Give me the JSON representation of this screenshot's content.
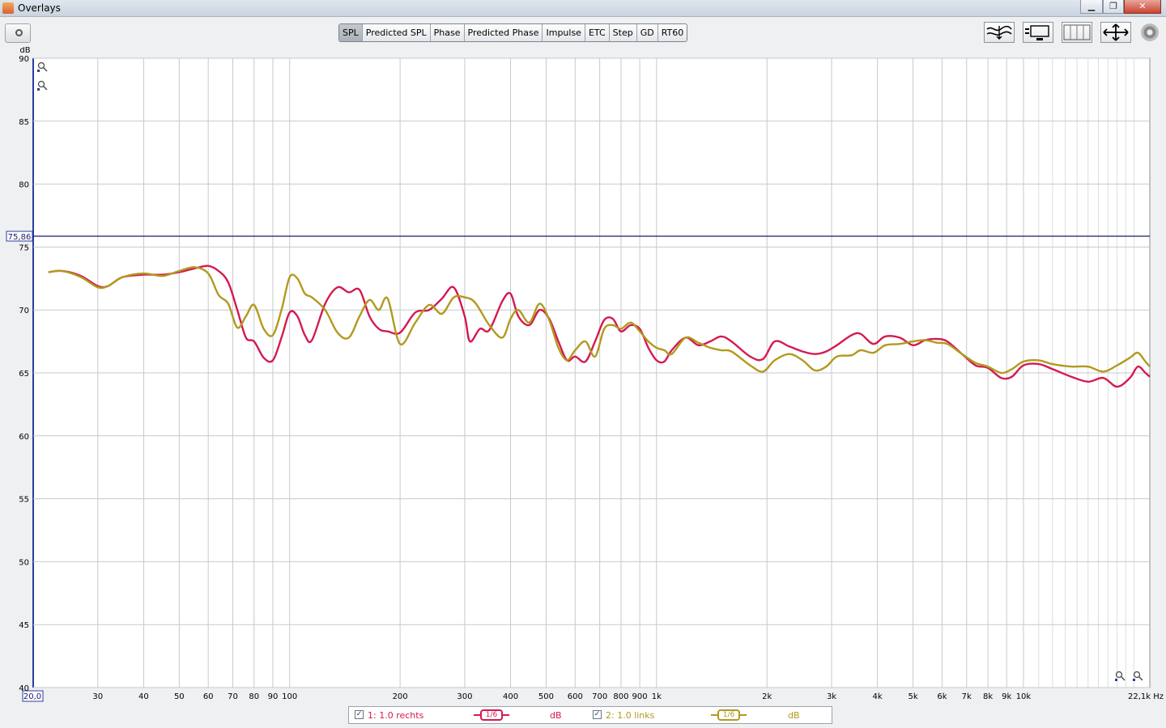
{
  "window": {
    "title": "Overlays",
    "btn_min": "▁",
    "btn_max": "❐",
    "btn_close": "✕"
  },
  "toolbar": {
    "tabs": [
      "SPL",
      "Predicted SPL",
      "Phase",
      "Predicted Phase",
      "Impulse",
      "ETC",
      "Step",
      "GD",
      "RT60"
    ],
    "active_tab": "SPL",
    "icons": [
      "capture-camera-icon",
      "align-traces-icon",
      "trace-arrangement-icon",
      "vertical-lines-icon",
      "fit-to-view-icon",
      "settings-gear-icon"
    ]
  },
  "chart": {
    "y_unit": "dB",
    "y_ticks": [
      "90",
      "85",
      "80",
      "75",
      "70",
      "65",
      "60",
      "55",
      "50",
      "45",
      "40"
    ],
    "x_ticks": [
      "30",
      "40",
      "50",
      "60",
      "70",
      "80",
      "90",
      "100",
      "200",
      "300",
      "400",
      "500",
      "600",
      "700",
      "800",
      "900",
      "1k",
      "2k",
      "3k",
      "4k",
      "5k",
      "6k",
      "7k",
      "8k",
      "9k",
      "10k"
    ],
    "x_start_label": "20,0",
    "x_end_label": "22,1k Hz",
    "cursor_label": "75,86"
  },
  "chart_data": {
    "type": "line",
    "x_scale": "log",
    "xlim": [
      20,
      22100
    ],
    "ylim": [
      40,
      90
    ],
    "grid": true,
    "cursor_y": 75.86,
    "series": [
      {
        "name": "1: 1.0 rechts",
        "color": "#d41a50",
        "points": [
          [
            22,
            73
          ],
          [
            24,
            73.1
          ],
          [
            27,
            72.7
          ],
          [
            30,
            71.9
          ],
          [
            32,
            71.9
          ],
          [
            35,
            72.6
          ],
          [
            40,
            72.8
          ],
          [
            45,
            72.8
          ],
          [
            50,
            73
          ],
          [
            55,
            73.3
          ],
          [
            60,
            73.5
          ],
          [
            64,
            73.1
          ],
          [
            68,
            72.2
          ],
          [
            72,
            70
          ],
          [
            76,
            67.8
          ],
          [
            80,
            67.5
          ],
          [
            85,
            66.2
          ],
          [
            90,
            66
          ],
          [
            95,
            67.8
          ],
          [
            100,
            69.8
          ],
          [
            105,
            69.5
          ],
          [
            110,
            68
          ],
          [
            115,
            67.6
          ],
          [
            125,
            70.5
          ],
          [
            135,
            71.8
          ],
          [
            145,
            71.4
          ],
          [
            155,
            71.6
          ],
          [
            165,
            69.5
          ],
          [
            175,
            68.5
          ],
          [
            185,
            68.3
          ],
          [
            200,
            68.2
          ],
          [
            220,
            69.8
          ],
          [
            240,
            70
          ],
          [
            260,
            70.9
          ],
          [
            280,
            71.8
          ],
          [
            300,
            69.5
          ],
          [
            310,
            67.5
          ],
          [
            330,
            68.5
          ],
          [
            350,
            68.4
          ],
          [
            380,
            70.7
          ],
          [
            400,
            71.3
          ],
          [
            420,
            69.5
          ],
          [
            450,
            68.8
          ],
          [
            480,
            70
          ],
          [
            510,
            69.3
          ],
          [
            540,
            67.5
          ],
          [
            570,
            66
          ],
          [
            600,
            66.3
          ],
          [
            640,
            65.9
          ],
          [
            680,
            67.5
          ],
          [
            720,
            69.2
          ],
          [
            760,
            69.3
          ],
          [
            800,
            68.3
          ],
          [
            850,
            68.8
          ],
          [
            900,
            68.5
          ],
          [
            950,
            67
          ],
          [
            1000,
            66
          ],
          [
            1050,
            65.9
          ],
          [
            1100,
            66.8
          ],
          [
            1200,
            67.8
          ],
          [
            1300,
            67.2
          ],
          [
            1400,
            67.5
          ],
          [
            1500,
            67.9
          ],
          [
            1600,
            67.5
          ],
          [
            1800,
            66.3
          ],
          [
            1950,
            66.1
          ],
          [
            2100,
            67.5
          ],
          [
            2300,
            67.1
          ],
          [
            2500,
            66.7
          ],
          [
            2700,
            66.5
          ],
          [
            2900,
            66.7
          ],
          [
            3100,
            67.2
          ],
          [
            3400,
            68
          ],
          [
            3600,
            68.1
          ],
          [
            3900,
            67.3
          ],
          [
            4200,
            67.9
          ],
          [
            4600,
            67.8
          ],
          [
            5000,
            67.2
          ],
          [
            5400,
            67.6
          ],
          [
            5800,
            67.7
          ],
          [
            6200,
            67.5
          ],
          [
            6800,
            66.5
          ],
          [
            7400,
            65.6
          ],
          [
            8000,
            65.4
          ],
          [
            8700,
            64.6
          ],
          [
            9300,
            64.7
          ],
          [
            10000,
            65.6
          ],
          [
            11000,
            65.7
          ],
          [
            12000,
            65.3
          ],
          [
            13500,
            64.7
          ],
          [
            15000,
            64.3
          ],
          [
            16500,
            64.6
          ],
          [
            18000,
            63.9
          ],
          [
            19500,
            64.6
          ],
          [
            20500,
            65.5
          ],
          [
            21500,
            65
          ],
          [
            22100,
            64.7
          ]
        ]
      },
      {
        "name": "2: 1.0 links",
        "color": "#b29a1e",
        "points": [
          [
            22,
            73
          ],
          [
            24,
            73.1
          ],
          [
            27,
            72.6
          ],
          [
            30,
            71.8
          ],
          [
            32,
            71.9
          ],
          [
            35,
            72.6
          ],
          [
            40,
            72.9
          ],
          [
            45,
            72.7
          ],
          [
            50,
            73.1
          ],
          [
            55,
            73.4
          ],
          [
            60,
            72.9
          ],
          [
            64,
            71.2
          ],
          [
            68,
            70.5
          ],
          [
            72,
            68.6
          ],
          [
            76,
            69.5
          ],
          [
            80,
            70.4
          ],
          [
            85,
            68.5
          ],
          [
            90,
            68
          ],
          [
            95,
            70
          ],
          [
            100,
            72.6
          ],
          [
            105,
            72.5
          ],
          [
            110,
            71.3
          ],
          [
            115,
            71
          ],
          [
            125,
            70
          ],
          [
            135,
            68.2
          ],
          [
            145,
            67.8
          ],
          [
            155,
            69.5
          ],
          [
            165,
            70.8
          ],
          [
            175,
            70
          ],
          [
            185,
            70.9
          ],
          [
            200,
            67.3
          ],
          [
            220,
            69
          ],
          [
            240,
            70.4
          ],
          [
            260,
            69.7
          ],
          [
            280,
            71
          ],
          [
            300,
            71
          ],
          [
            320,
            70.6
          ],
          [
            350,
            68.8
          ],
          [
            380,
            67.8
          ],
          [
            400,
            69.3
          ],
          [
            420,
            70
          ],
          [
            450,
            69
          ],
          [
            480,
            70.5
          ],
          [
            510,
            69.2
          ],
          [
            540,
            67
          ],
          [
            570,
            66
          ],
          [
            600,
            66.8
          ],
          [
            640,
            67.5
          ],
          [
            680,
            66.3
          ],
          [
            720,
            68.5
          ],
          [
            760,
            68.8
          ],
          [
            800,
            68.5
          ],
          [
            850,
            69
          ],
          [
            900,
            68.3
          ],
          [
            950,
            67.5
          ],
          [
            1000,
            67
          ],
          [
            1050,
            66.8
          ],
          [
            1100,
            66.5
          ],
          [
            1200,
            67.8
          ],
          [
            1300,
            67.4
          ],
          [
            1400,
            67
          ],
          [
            1500,
            66.8
          ],
          [
            1600,
            66.7
          ],
          [
            1800,
            65.6
          ],
          [
            1950,
            65.1
          ],
          [
            2100,
            66
          ],
          [
            2300,
            66.5
          ],
          [
            2500,
            66
          ],
          [
            2700,
            65.2
          ],
          [
            2900,
            65.5
          ],
          [
            3100,
            66.3
          ],
          [
            3400,
            66.4
          ],
          [
            3600,
            66.8
          ],
          [
            3900,
            66.6
          ],
          [
            4200,
            67.2
          ],
          [
            4600,
            67.3
          ],
          [
            5000,
            67.5
          ],
          [
            5400,
            67.6
          ],
          [
            5800,
            67.4
          ],
          [
            6200,
            67.3
          ],
          [
            6800,
            66.5
          ],
          [
            7400,
            65.8
          ],
          [
            8000,
            65.5
          ],
          [
            8700,
            65
          ],
          [
            9300,
            65.3
          ],
          [
            10000,
            65.9
          ],
          [
            11000,
            66
          ],
          [
            12000,
            65.7
          ],
          [
            13500,
            65.5
          ],
          [
            15000,
            65.5
          ],
          [
            16500,
            65.1
          ],
          [
            18000,
            65.6
          ],
          [
            19500,
            66.2
          ],
          [
            20500,
            66.6
          ],
          [
            21500,
            65.9
          ],
          [
            22100,
            65.5
          ]
        ]
      }
    ]
  },
  "legend": {
    "items": [
      {
        "label": "1: 1.0 rechts",
        "smoothing": "1/6",
        "unit": "dB",
        "checked": true,
        "color": "#d41a50"
      },
      {
        "label": "2: 1.0 links",
        "smoothing": "1/6",
        "unit": "dB",
        "checked": true,
        "color": "#b29a1e"
      }
    ]
  }
}
